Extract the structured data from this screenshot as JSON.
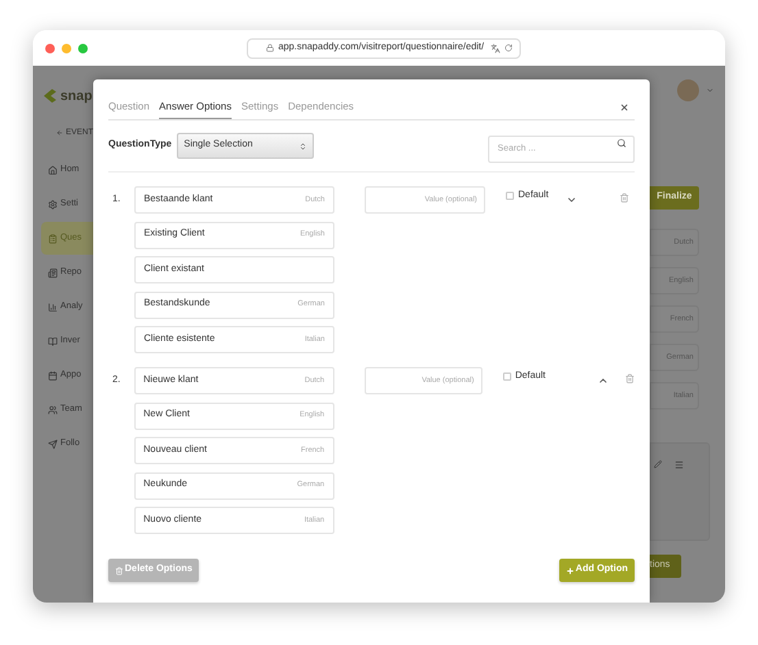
{
  "browser": {
    "url": "app.snapaddy.com/visitreport/questionnaire/edit/"
  },
  "app": {
    "logo": "snap",
    "back_link": "EVENT",
    "sidebar": {
      "items": [
        {
          "label": "Hom",
          "kind": "home",
          "selected": false
        },
        {
          "label": "Setti",
          "kind": "settings",
          "selected": false
        },
        {
          "label": "Ques",
          "kind": "questionnaire",
          "selected": true
        },
        {
          "label": "Repo",
          "kind": "reports",
          "selected": false
        },
        {
          "label": "Analy",
          "kind": "analytics",
          "selected": false
        },
        {
          "label": "Inver",
          "kind": "book",
          "selected": false
        },
        {
          "label": "Appo",
          "kind": "calendar",
          "selected": false
        },
        {
          "label": "Team",
          "kind": "team",
          "selected": false
        },
        {
          "label": "Follo",
          "kind": "send",
          "selected": false
        }
      ]
    },
    "finalize_button": "Finalize",
    "language_chips": [
      "Dutch",
      "English",
      "French",
      "German",
      "Italian"
    ],
    "bottom_button": "tions"
  },
  "dialog": {
    "tabs": [
      {
        "label": "Question",
        "selected": false
      },
      {
        "label": "Answer Options",
        "selected": true
      },
      {
        "label": "Settings",
        "selected": false
      },
      {
        "label": "Dependencies",
        "selected": false
      }
    ],
    "question_type": {
      "label": "QuestionType",
      "value": "Single Selection"
    },
    "search": {
      "placeholder": "Search ..."
    },
    "options": [
      {
        "number": "1.",
        "translations": [
          {
            "text": "Bestaande klant",
            "language": "Dutch"
          },
          {
            "text": "Existing Client",
            "language": "English"
          },
          {
            "text": "Client existant"
          },
          {
            "text": "Bestandskunde",
            "language": "German"
          },
          {
            "text": "Cliente esistente",
            "language": "Italian"
          }
        ],
        "value_placeholder": "Value (optional)",
        "default_label": "Default",
        "default_checked": false,
        "arrow_up": false
      },
      {
        "number": "2.",
        "translations": [
          {
            "text": "Nieuwe klant",
            "language": "Dutch"
          },
          {
            "text": "New Client",
            "language": "English"
          },
          {
            "text": "Nouveau client",
            "language": "French"
          },
          {
            "text": "Neukunde",
            "language": "German"
          },
          {
            "text": "Nuovo cliente",
            "language": "Italian"
          }
        ],
        "value_placeholder": "Value (optional)",
        "default_label": "Default",
        "default_checked": false,
        "arrow_up": true
      }
    ],
    "delete_button": {
      "label": "Delete Options",
      "disabled": true
    },
    "add_button": "Add Option"
  }
}
